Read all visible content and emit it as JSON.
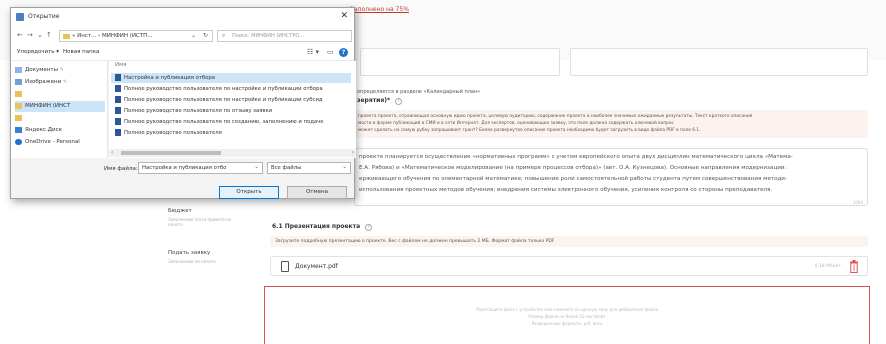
{
  "colors": {
    "accent": "#0078d7",
    "progress": "#c0392b",
    "drop_border": "#d9534f",
    "selection": "#cce4f7"
  },
  "page": {
    "progress_text": "Заполнено на 75%",
    "calendar_note": "определяется в разделе «Календарный план»",
    "goal_heading": "зерятия)*",
    "hint1_line1": "проекта проекта, отражающая основную идею проекта, целевую аудиторию, содержание проекта и наиболее значимые ожидаемые результаты. Текст краткого описания",
    "hint1_line2": "мости в форме публикаций в СМИ и в сети Интернет. Для экспертов, оценивающих заявку, это поле должно содержать ключевой вопрос",
    "hint1_line3": "может сделать на самую рубку запрашивает грант? Более развернутое описание проекта необходимо будет загрузить в виде файла PDF в поле 6.1.",
    "desc_line1": "проекте планируется осуществление «нормативных программ» с учетом европейского опыта двух дисциплин математического цикла «Матема-",
    "desc_line2": "Е.А. Рябова) и «Математическое моделирование (на примере процессов отбора)» (авт. О.А. Кузнецова). Основные направления модернизации:",
    "desc_line3": "ерживающего обучения по элементарной математике; повышение роли самостоятельной работы студента путем совершенствования методи-",
    "desc_line4": "использования проектных методов обучения; внедрения системы электронного обучения, усиления контроля со стороны преподавателя.",
    "char_count": "1000",
    "nav_budget": "Бюджет",
    "nav_budget_sub": "Заполнение этого проекта не начато",
    "nav_submit": "Подать заявку",
    "nav_submit_sub": "Заполнение не начато",
    "section_title": "6.1 Презентация проекта",
    "section_help": "?",
    "upload_hint": "Загрузите подробную презентацию о проекте. Вес с файлом не должен превышать 2 МБ. Формат файла только PDF",
    "file_name": "Документ.pdf",
    "file_size": "0,18 Мбайт",
    "drop_line1": "Перетащите файл с устройства или кликните на данную зону для добавления файла",
    "drop_line2": "Размер файла не более 10 мегабайт",
    "drop_line3": "Разрешенные форматы: pdf, docx"
  },
  "dialog": {
    "title": "Открытие",
    "close": "✕",
    "path": "« Инст... › МИНФИН (ИСТП...",
    "search_placeholder": "Поиск: МИНФИН (ИНСТРО...",
    "organize": "Упорядочить ▾",
    "new_folder": "Новая папка",
    "view_glyph": "☷ ▾",
    "pane_glyph": "▭",
    "help": "?",
    "tree": [
      "Документы",
      "Изображени",
      "",
      "МИНФИН (ИНСТ",
      "",
      "Яндекс.Диск",
      "OneDrive - Personal"
    ],
    "column_name": "Имя",
    "files": [
      "Настройка и публикация отбора",
      "Полное руководство пользователя по настройке и публикации отбора",
      "Полное руководство пользователя по настройке и публикации субсид",
      "Полное руководство пользователя по отзыву заявки",
      "Полное руководство пользователя по созданию, заполнению и подаче",
      "Полное руководство пользователя"
    ],
    "filename_label": "Имя файла:",
    "filename_value": "Настройка и публикация отбо",
    "filter_value": "Все файлы",
    "open_button": "Открыть",
    "cancel_button": "Отмена",
    "chev": "⌄",
    "arrow_left": "‹",
    "arrow_right": "›"
  }
}
